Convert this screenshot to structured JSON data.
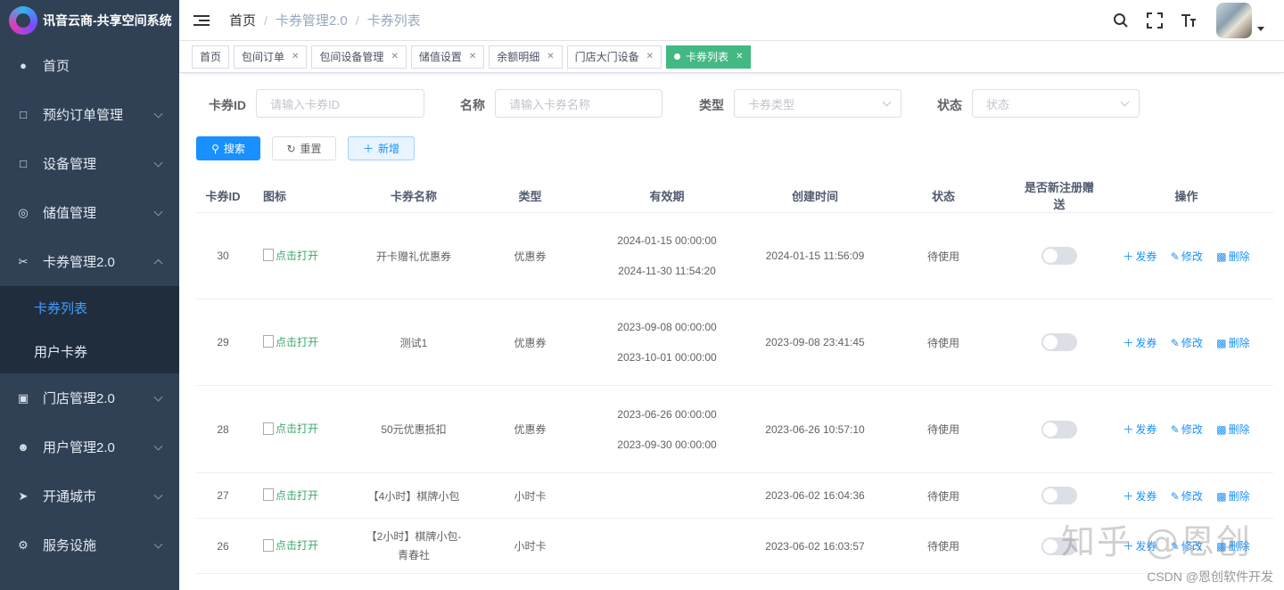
{
  "app": {
    "title": "讯音云商-共享空间系统"
  },
  "sidebar": {
    "items": [
      {
        "label": "首页",
        "icon": "dashboard-icon"
      },
      {
        "label": "预约订单管理",
        "icon": "document-icon"
      },
      {
        "label": "设备管理",
        "icon": "device-icon"
      },
      {
        "label": "储值管理",
        "icon": "wallet-icon"
      },
      {
        "label": "卡券管理2.0",
        "icon": "coupon-icon"
      }
    ],
    "subitems": [
      {
        "label": "卡券列表",
        "active": true
      },
      {
        "label": "用户卡券",
        "active": false
      }
    ],
    "items_after": [
      {
        "label": "门店管理2.0",
        "icon": "store-icon"
      },
      {
        "label": "用户管理2.0",
        "icon": "user-icon"
      },
      {
        "label": "开通城市",
        "icon": "location-icon"
      },
      {
        "label": "服务设施",
        "icon": "gear-icon"
      }
    ]
  },
  "breadcrumb": [
    "首页",
    "卡券管理2.0",
    "卡券列表"
  ],
  "tags": [
    "首页",
    "包间订单",
    "包间设备管理",
    "储值设置",
    "余额明细",
    "门店大门设备",
    "卡券列表"
  ],
  "filters": {
    "id_label": "卡券ID",
    "id_placeholder": "请输入卡券ID",
    "name_label": "名称",
    "name_placeholder": "请输入卡券名称",
    "type_label": "类型",
    "type_placeholder": "卡券类型",
    "status_label": "状态",
    "status_placeholder": "状态"
  },
  "buttons": {
    "search": "搜索",
    "reset": "重置",
    "add": "新增"
  },
  "table": {
    "headers": [
      "卡券ID",
      "图标",
      "卡券名称",
      "类型",
      "有效期",
      "创建时间",
      "状态",
      "是否新注册赠送",
      "操作"
    ],
    "icon_alt": "点击打开",
    "ops": {
      "issue": "发券",
      "edit": "修改",
      "delete": "删除"
    },
    "rows": [
      {
        "id": "30",
        "name": "开卡赠礼优惠券",
        "type": "优惠券",
        "valid_start": "2024-01-15 00:00:00",
        "valid_end": "2024-11-30 11:54:20",
        "created": "2024-01-15 11:56:09",
        "status": "待使用"
      },
      {
        "id": "29",
        "name": "测试1",
        "type": "优惠券",
        "valid_start": "2023-09-08 00:00:00",
        "valid_end": "2023-10-01 00:00:00",
        "created": "2023-09-08 23:41:45",
        "status": "待使用"
      },
      {
        "id": "28",
        "name": "50元优惠抵扣",
        "type": "优惠券",
        "valid_start": "2023-06-26 00:00:00",
        "valid_end": "2023-09-30 00:00:00",
        "created": "2023-06-26 10:57:10",
        "status": "待使用"
      },
      {
        "id": "27",
        "name": "【4小时】棋牌小包",
        "type": "小时卡",
        "valid_start": "",
        "valid_end": "",
        "created": "2023-06-02 16:04:36",
        "status": "待使用"
      },
      {
        "id": "26",
        "name_line1": "【2小时】棋牌小包-",
        "name_line2": "青春社",
        "type": "小时卡",
        "valid_start": "",
        "valid_end": "",
        "created": "2023-06-02 16:03:57",
        "status": "待使用"
      }
    ]
  },
  "watermark": {
    "text": "知乎 @恩创",
    "credit": "CSDN @恩创软件开发"
  }
}
